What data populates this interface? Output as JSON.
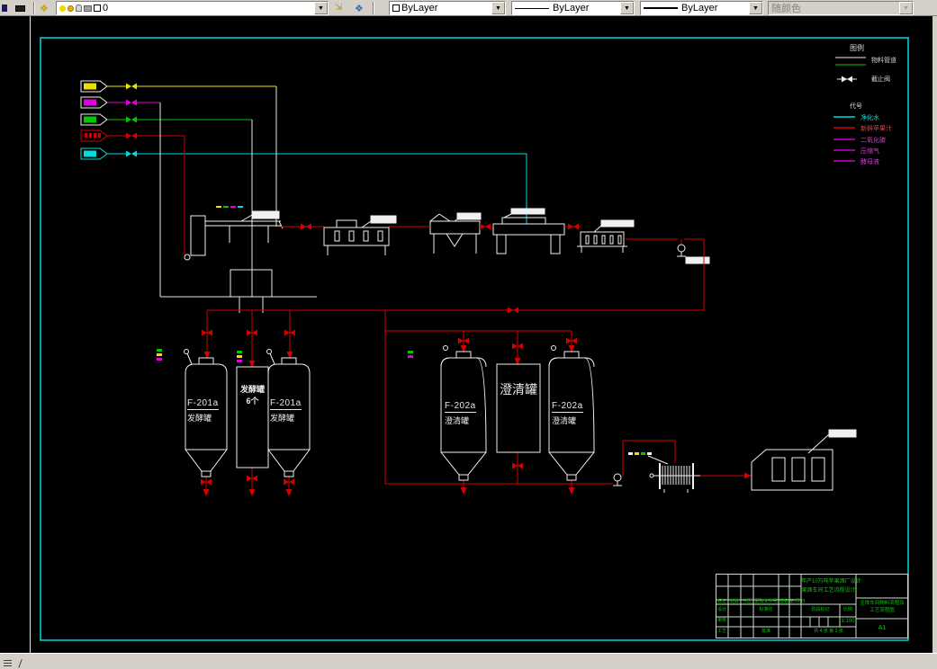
{
  "toolbar": {
    "layer_value": "0",
    "color_value": "ByLayer",
    "linetype_value": "ByLayer",
    "lineweight_value": "ByLayer",
    "plot_style_value": "随颜色"
  },
  "legend": {
    "title": "图例",
    "pipe_label": "物料管道",
    "valve_label": "截止阀"
  },
  "color_legend": {
    "title": "代号",
    "items": [
      {
        "label": "净化水",
        "color": "#00dcdc"
      },
      {
        "label": "新鲜苹果汁",
        "color": "#dc2020"
      },
      {
        "label": "二氧化碳",
        "color": "#cc00cc"
      },
      {
        "label": "压缩气",
        "color": "#cc00cc"
      },
      {
        "label": "酵母液",
        "color": "#cc00cc"
      }
    ]
  },
  "diagram": {
    "ferment_tank_left": {
      "code": "F-201a",
      "name": "发酵罐"
    },
    "ferment_tank_mid": {
      "line1": "发酵罐",
      "line2": "6个"
    },
    "ferment_tank_right": {
      "code": "F-201a",
      "name": "发酵罐"
    },
    "clarify_tank_left": {
      "code": "F-202a",
      "name": "澄清罐"
    },
    "clarify_tank_mid": {
      "name": "澄清罐"
    },
    "clarify_tank_right": {
      "code": "F-202a",
      "name": "澄清罐"
    }
  },
  "title_block": {
    "project_line1": "年产10万吨苹果酒厂设计",
    "project_line2": "果酒车间工艺流程设计",
    "drawing_title_line1": "主体车间物料流程及",
    "drawing_title_line2": "工艺流程图",
    "sheet_size": "A1",
    "stage_label": "阶段标记",
    "scale_label": "比例",
    "scale_value": "1:100",
    "sheet_info": "共 4 张 第 3 张",
    "header_row": [
      "标记",
      "处数",
      "分区",
      "更改文件号",
      "签名",
      "年.月.日"
    ],
    "row_design": "设计",
    "row_standard": "标准化",
    "row_check": "审核",
    "row_craft": "工艺",
    "row_approve": "批准",
    "accent_color": "#00cc00"
  }
}
